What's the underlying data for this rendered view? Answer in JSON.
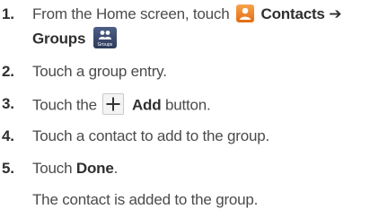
{
  "steps": [
    {
      "number": "1.",
      "text_before": "From the Home screen, touch",
      "contacts_label": "Contacts",
      "arrow": "➔",
      "groups_label": "Groups",
      "groups_icon_caption": "Groups",
      "icons": [
        "contacts-app-icon",
        "groups-tab-icon"
      ]
    },
    {
      "number": "2.",
      "text": "Touch a group entry."
    },
    {
      "number": "3.",
      "text_before": "Touch the",
      "add_label": "Add",
      "text_after": "button.",
      "icons": [
        "plus-icon"
      ]
    },
    {
      "number": "4.",
      "text": "Touch a contact to add to the group."
    },
    {
      "number": "5.",
      "text_before": "Touch",
      "done_label": "Done",
      "text_after": "."
    }
  ],
  "result_text": "The contact is added to the group."
}
